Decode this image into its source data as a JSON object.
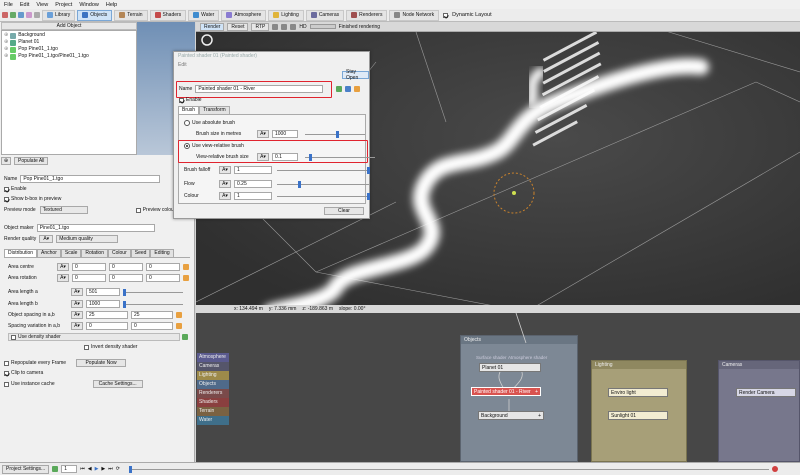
{
  "menu": [
    "File",
    "Edit",
    "View",
    "Project",
    "Window",
    "Help"
  ],
  "toolbar": {
    "tabs": [
      {
        "label": "Library",
        "icon": "library-icon",
        "color": "#6a9fd8"
      },
      {
        "label": "Objects",
        "icon": "objects-icon",
        "color": "#3b73c2"
      },
      {
        "label": "Terrain",
        "icon": "terrain-icon",
        "color": "#b48656"
      },
      {
        "label": "Shaders",
        "icon": "shaders-icon",
        "color": "#c44a4a"
      },
      {
        "label": "Water",
        "icon": "water-icon",
        "color": "#3f8ccf"
      },
      {
        "label": "Atmosphere",
        "icon": "atmosphere-icon",
        "color": "#8a7bd1"
      },
      {
        "label": "Lighting",
        "icon": "lighting-icon",
        "color": "#e0b43a"
      },
      {
        "label": "Cameras",
        "icon": "cameras-icon",
        "color": "#6b6b9e"
      },
      {
        "label": "Renderers",
        "icon": "renderers-icon",
        "color": "#a05050"
      },
      {
        "label": "Node Network",
        "icon": "node-network-icon",
        "color": "#888888"
      }
    ],
    "dynamic_layout": "Dynamic Layout"
  },
  "left": {
    "add_object": "Add Object",
    "tree": [
      {
        "label": "Background",
        "icon": "background-icon"
      },
      {
        "label": "Planet 01",
        "icon": "planet-icon"
      },
      {
        "label": "Pop Pine01_1.tgo",
        "icon": "population-icon"
      },
      {
        "label": "Pop Pine01_1.tgo/Pine01_1.tgo",
        "icon": "population-icon"
      }
    ],
    "populate_all": "Populate All",
    "name_label": "Name",
    "name_value": "Pop Pine01_1.tgo",
    "enable": "Enable",
    "show_bbox": "Show b-box in preview",
    "preview_mode_label": "Preview mode",
    "preview_mode_value": "Textured",
    "preview_colour": "Preview colour",
    "object_maker_label": "Object maker",
    "object_maker_value": "Pine01_1.tgo",
    "render_quality_label": "Render quality",
    "render_quality_value": "Medium quality",
    "tabs": [
      "Distribution",
      "Anchor",
      "Scale",
      "Rotation",
      "Colour",
      "Seed",
      "Editing"
    ],
    "area_centre": {
      "label": "Area centre",
      "v": [
        "0",
        "0",
        "0"
      ]
    },
    "area_rotation": {
      "label": "Area rotation",
      "v": [
        "0",
        "0",
        "0"
      ]
    },
    "area_length_a": {
      "label": "Area length a",
      "v": "501"
    },
    "area_length_b": {
      "label": "Area length b",
      "v": "1000"
    },
    "object_spacing": {
      "label": "Object spacing in a,b",
      "v": [
        "25",
        "25"
      ]
    },
    "spacing_variation": {
      "label": "Spacing variation in a,b",
      "v": [
        "0",
        "0"
      ]
    },
    "use_density_shader": "Use density shader",
    "invert_density_shader": "Invert density shader",
    "repopulate": "Repopulate every Frame",
    "populate_now": "Populate Now",
    "clip_to_camera": "Clip to camera",
    "use_instance_cache": "Use instance cache",
    "cache_settings": "Cache Settings..."
  },
  "viewport": {
    "render_label": "Render",
    "reset_label": "Reset",
    "rtp_label": "RTP",
    "hd_label": "HD",
    "status": "Finished rendering",
    "coords": {
      "x": "x: 134.494 m",
      "y": "y: 7.336 mm",
      "z": "z: -189.863 m",
      "slope": "slope: 0.00°"
    }
  },
  "dialog": {
    "title": "Painted shader 01   (Painted shader)",
    "edit": "Edit",
    "stay_open": "Stay Open",
    "name_label": "Name",
    "name_value": "Painted shader 01 - River",
    "enable": "Enable",
    "tabs": [
      "Brush",
      "Transform"
    ],
    "use_absolute_brush": "Use absolute brush",
    "brush_size_metres_label": "Brush size in metres",
    "brush_size_metres_value": "1000",
    "use_view_relative": "Use view-relative brush",
    "view_relative_size_label": "View-relative brush size",
    "view_relative_size_value": "0.1",
    "brush_falloff_label": "Brush falloff",
    "brush_falloff_value": "1",
    "flow_label": "Flow",
    "flow_value": "0.25",
    "colour_label": "Colour",
    "colour_value": "1",
    "clear": "Clear",
    "sliders": {
      "brush_size": 0.55,
      "view_relative": 0.08,
      "falloff": 1.0,
      "flow": 0.25,
      "colour": 1.0
    }
  },
  "graph": {
    "side_list": [
      {
        "label": "Atmosphere",
        "color": "#5a5a8e"
      },
      {
        "label": "Cameras",
        "color": "#55556a"
      },
      {
        "label": "Lighting",
        "color": "#9d8a4a"
      },
      {
        "label": "Objects",
        "color": "#4f6a8a"
      },
      {
        "label": "Renderers",
        "color": "#7a4a4a"
      },
      {
        "label": "Shaders",
        "color": "#8a3f3f"
      },
      {
        "label": "Terrain",
        "color": "#7a6242"
      },
      {
        "label": "Water",
        "color": "#3f6f8a"
      }
    ],
    "groups": {
      "objects": "Objects",
      "lighting": "Lighting",
      "cameras": "Cameras"
    },
    "ports": {
      "surface_shader": "Surface shader",
      "atmosphere_shader": "Atmosphere shader"
    },
    "nodes": {
      "planet": "Planet 01",
      "painted": "Painted shader 01 - River",
      "background": "Background",
      "enviro": "Enviro light",
      "sunlight": "Sunlight 01",
      "render_camera": "Render Camera"
    }
  },
  "footer": {
    "project_settings": "Project Settings...",
    "frame": "1"
  }
}
